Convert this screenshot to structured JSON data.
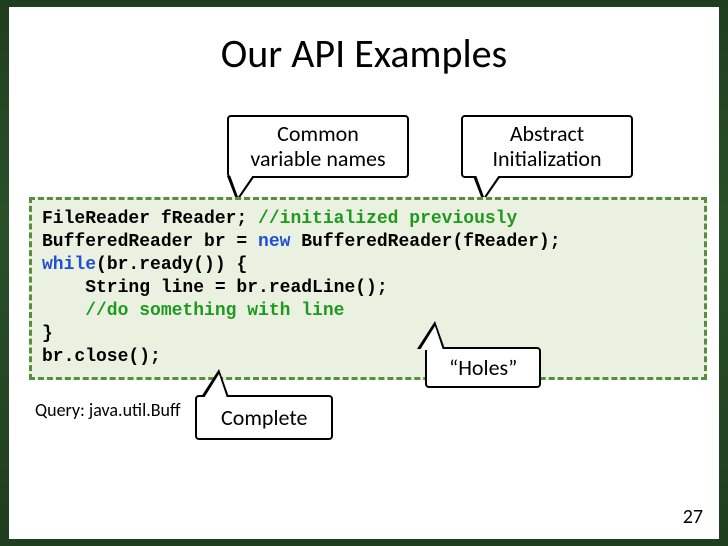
{
  "title": "Our API Examples",
  "callouts": {
    "common": {
      "line1": "Common",
      "line2": "variable names"
    },
    "abstract": {
      "line1": "Abstract",
      "line2": "Initialization"
    },
    "holes": {
      "text": "“Holes”"
    },
    "complete": {
      "text": "Complete"
    }
  },
  "code": {
    "l1a": "FileReader fReader; ",
    "l1b": "//initialized previously",
    "l2a": "BufferedReader br = ",
    "l2b": "new",
    "l2c": " BufferedReader(fReader);",
    "l3a": "while",
    "l3b": "(br.ready()) {",
    "l4": "    String line = br.readLine();",
    "l5": "    //do something with line",
    "l6": "}",
    "l7": "br.close();"
  },
  "query": "Query: java.util.Buff",
  "page_number": "27"
}
